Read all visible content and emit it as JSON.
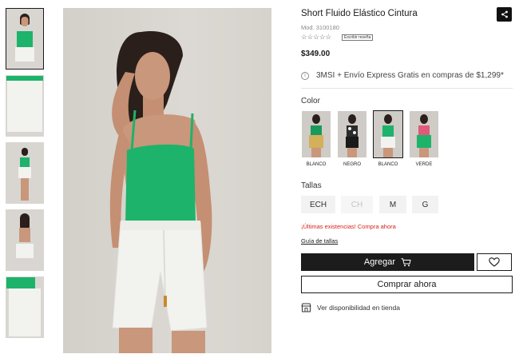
{
  "product": {
    "title": "Short Fluido Elástico Cintura",
    "model": "Mod. 3100180",
    "stars": "☆☆☆☆☆",
    "review_label": "Escribir reseña",
    "price": "$349.00",
    "promo": "3MSI + Envío Express Gratis en compras de $1,299*"
  },
  "color": {
    "label": "Color",
    "options": [
      {
        "label": "BLANCO",
        "top_color": "#1a9a5a"
      },
      {
        "label": "NEGRO",
        "top_color": "#2b2b2b"
      },
      {
        "label": "BLANCO",
        "top_color": "#1db36a"
      },
      {
        "label": "VERDE",
        "top_color": "#1db36a"
      }
    ],
    "selected_index": 2
  },
  "sizes": {
    "label": "Tallas",
    "options": [
      {
        "label": "ECH",
        "available": true
      },
      {
        "label": "CH",
        "available": false
      },
      {
        "label": "M",
        "available": true
      },
      {
        "label": "G",
        "available": true
      }
    ]
  },
  "stock_message": "¡Últimas existencias! Compra ahora",
  "size_guide": "Guía de tallas",
  "actions": {
    "add_label": "Agregar",
    "buy_label": "Comprar ahora",
    "store_label": "Ver disponibilidad en tienda"
  },
  "icons": {
    "share": "share-icon",
    "info": "info-icon",
    "cart": "cart-icon",
    "heart": "heart-icon",
    "store": "store-icon"
  },
  "colors": {
    "accent": "#1c1c1c",
    "alert": "#d6211b",
    "garment_green": "#1db36a"
  }
}
